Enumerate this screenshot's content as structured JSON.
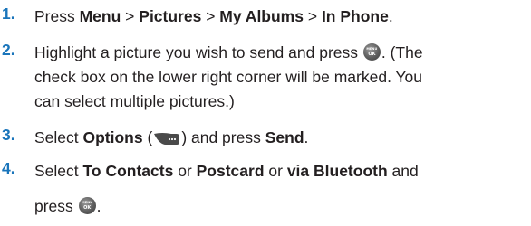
{
  "steps": [
    {
      "number": "1.",
      "lines": [
        {
          "a": "Press ",
          "b": "Menu",
          "c": " > ",
          "d": "Pictures",
          "e": " > ",
          "f": "My Albums",
          "g": " > ",
          "h": "In Phone",
          "i": "."
        }
      ]
    },
    {
      "number": "2.",
      "lines": [
        {
          "a": "Highlight a picture you wish to send and press ",
          "b": ". (The"
        },
        {
          "a": "check box on the lower right corner will be marked. You"
        },
        {
          "a": "can select multiple pictures.)"
        }
      ]
    },
    {
      "number": "3.",
      "lines": [
        {
          "a": "Select ",
          "b": "Options",
          "c": " (",
          "d": ") and press ",
          "e": "Send",
          "f": "."
        }
      ]
    },
    {
      "number": "4.",
      "lines": [
        {
          "a": "Select ",
          "b": "To Contacts",
          "c": " or ",
          "d": "Postcard",
          "e": " or ",
          "f": "via Bluetooth",
          "g": " and"
        },
        {
          "a": "press ",
          "b": "."
        }
      ]
    }
  ],
  "icons": {
    "menu_ok_key": "menu-ok-key-icon",
    "options_softkey": "options-softkey-icon"
  },
  "colors": {
    "step_number": "#1a75bb",
    "text": "#231f20",
    "key_icon": "#5d5d5d"
  }
}
